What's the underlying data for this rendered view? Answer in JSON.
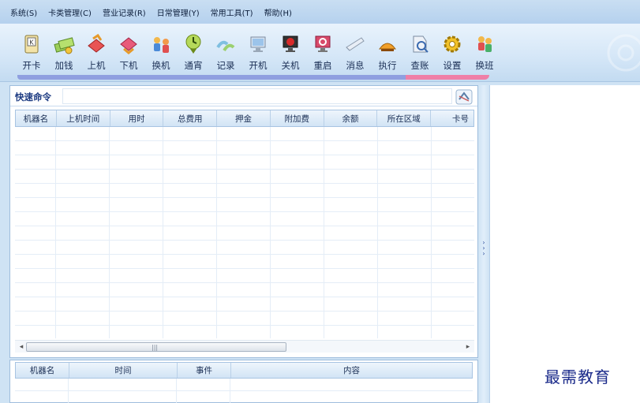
{
  "menu": [
    "系统(S)",
    "卡类管理(C)",
    "营业记录(R)",
    "日常管理(Y)",
    "常用工具(T)",
    "帮助(H)"
  ],
  "toolbar": [
    {
      "label": "开卡",
      "icon": "open-card-icon"
    },
    {
      "label": "加钱",
      "icon": "add-money-icon"
    },
    {
      "label": "上机",
      "icon": "login-icon"
    },
    {
      "label": "下机",
      "icon": "logout-icon"
    },
    {
      "label": "换机",
      "icon": "switch-machine-icon"
    },
    {
      "label": "通宵",
      "icon": "overnight-icon"
    },
    {
      "label": "记录",
      "icon": "records-icon"
    },
    {
      "label": "开机",
      "icon": "power-on-icon"
    },
    {
      "label": "关机",
      "icon": "power-off-icon"
    },
    {
      "label": "重启",
      "icon": "restart-icon"
    },
    {
      "label": "消息",
      "icon": "message-icon"
    },
    {
      "label": "执行",
      "icon": "execute-icon"
    },
    {
      "label": "查账",
      "icon": "check-accounts-icon"
    },
    {
      "label": "设置",
      "icon": "settings-gear-icon"
    },
    {
      "label": "换班",
      "icon": "shift-change-icon"
    }
  ],
  "quick": {
    "label": "快速命令",
    "value": ""
  },
  "grid": {
    "columns": [
      "机器名",
      "上机时间",
      "用时",
      "总费用",
      "押金",
      "附加费",
      "余额",
      "所在区域",
      "卡号"
    ]
  },
  "scroll": {
    "grip": "|||",
    "left": "◂",
    "right": "▸"
  },
  "log": {
    "columns": [
      "机器名",
      "时间",
      "事件",
      "内容"
    ]
  },
  "watermark": "最需教育",
  "colors": {
    "toolbar_underline_blue": "#8f9fe0",
    "toolbar_underline_pink": "#ef7fa7",
    "accent": "#1d3b82"
  }
}
